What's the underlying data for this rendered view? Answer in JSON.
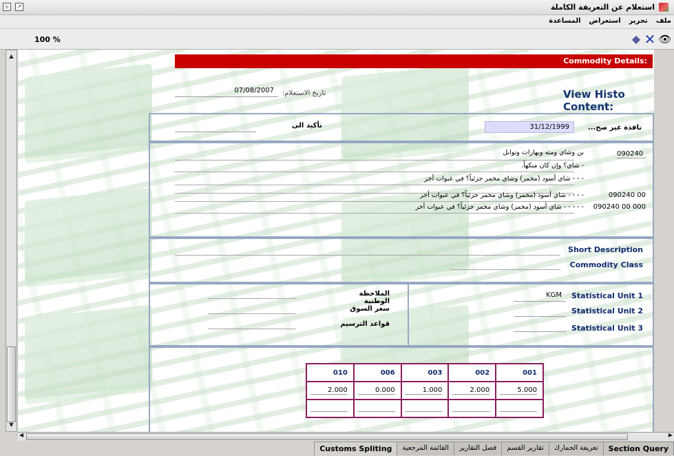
{
  "window": {
    "title": "استعلام عن التعريفة الكاملة",
    "menu": [
      "ملف",
      "تحرير",
      "استعراض",
      "المساعدة"
    ]
  },
  "toolbar": {
    "zoom": "100 %"
  },
  "header": {
    "commodity_details": "Commodity Details:"
  },
  "query": {
    "view_histo": "View Histo Content:",
    "date_label": "تاريخ الاستعلام:",
    "date_value": "07/08/2007"
  },
  "validity": {
    "invalid_label": "نافذة غير صح...",
    "invalid_value": "31/12/1999",
    "confirm_label": "تأكيد الى"
  },
  "tariff": {
    "lines": [
      {
        "code": "090240",
        "text": "بن وشاي ومته وبهارات وتوابل"
      },
      {
        "code": "",
        "text": "- شاي؟ وإن كان منكهاً."
      },
      {
        "code": "",
        "text": "- - -    شاي أسود (مخمر) وشاي مخمر جزئياً؟ في عبوات أخر"
      },
      {
        "code": "090240    00",
        "text": "- - -    -    شاي أسود (مخمر) وشاي مخمر جزئياً؟ في عبوات أخر"
      },
      {
        "code": "090240    00    000",
        "text": "- - - -    -    شاي أسود (مخمر) وشاي مخمر جزئياً؟ في عبوات أخر"
      }
    ]
  },
  "description": {
    "short_label": "Short Description",
    "class_label": "Commodity Class"
  },
  "units": {
    "unit1_label": "Statistical Unit 1",
    "unit1_value": "KGM",
    "unit2_label": "Statistical Unit 2",
    "unit3_label": "Statistical Unit 3",
    "national_note": "الملاحظة الوطنية",
    "market_price": "سعر السوق",
    "fee_rules": "قواعد الترسيم"
  },
  "duty_table": {
    "headers": [
      "010",
      "006",
      "003",
      "002",
      "001"
    ],
    "values": [
      "2.000",
      "0.000",
      "1.000",
      "2.000",
      "5.000"
    ]
  },
  "tabs": [
    {
      "label": "Section Query"
    },
    {
      "label": "تعريفة الجمارك"
    },
    {
      "label": "تقارير القسم"
    },
    {
      "label": "فصل التقارير"
    },
    {
      "label": "القائمة المرجعية"
    },
    {
      "label": "Customs Spliting"
    }
  ]
}
